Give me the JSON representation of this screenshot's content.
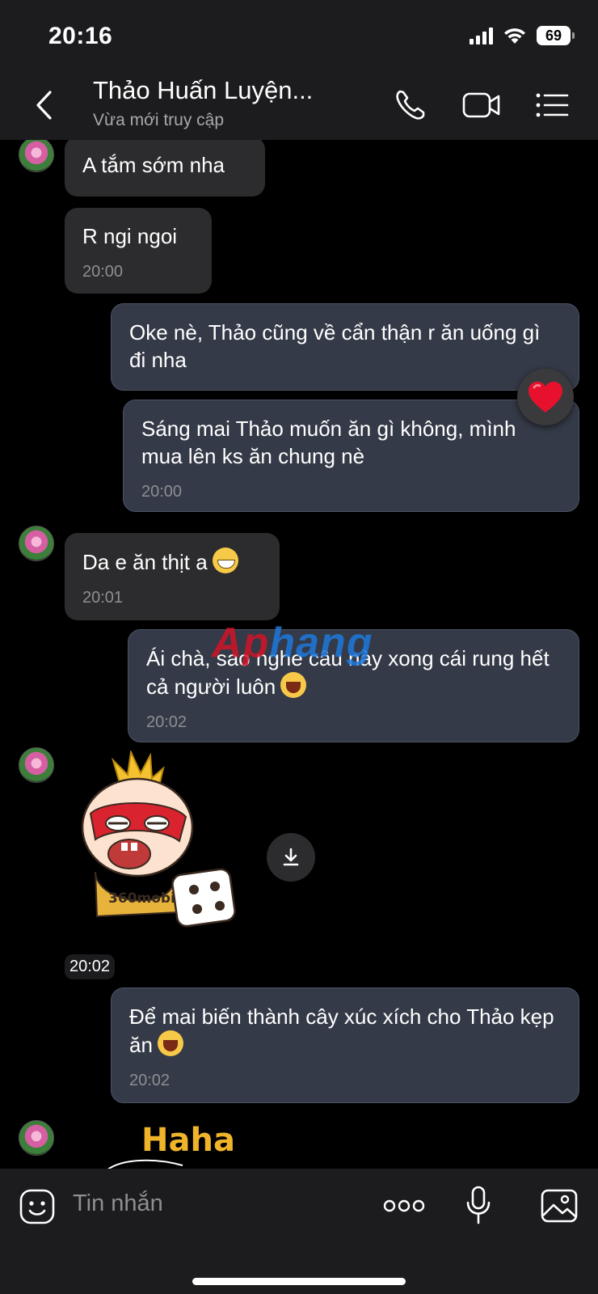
{
  "status_bar": {
    "time": "20:16",
    "battery": "69"
  },
  "header": {
    "back_icon": "chevron-left-icon",
    "contact_name": "Thảo Huấn Luyện...",
    "contact_status": "Vừa mới truy cập",
    "icons": [
      "phone-icon",
      "video-call-icon",
      "menu-list-icon"
    ]
  },
  "messages": [
    {
      "side": "in",
      "text": "A tắm sớm nha",
      "time": ""
    },
    {
      "side": "in",
      "text": "R ngi ngoi",
      "time": "20:00"
    },
    {
      "side": "out",
      "text": "Oke nè, Thảo cũng về cẩn thận r ăn uống gì đi nha",
      "time": ""
    },
    {
      "side": "out",
      "text": "Sáng mai Thảo muốn ăn gì không, mình mua lên ks ăn chung nè",
      "time": "20:00",
      "reaction": "heart-icon"
    },
    {
      "side": "in",
      "text": "Da e ăn thịt a",
      "emoji": "grin-emoji",
      "time": "20:01"
    },
    {
      "side": "out",
      "text": "Ái chà, sao nghe câu này xong cái rung hết cả người luôn",
      "emoji": "laugh-emoji",
      "time": "20:02"
    },
    {
      "side": "in",
      "type": "sticker",
      "sticker_text": "360mobi",
      "time": "20:02"
    },
    {
      "side": "out",
      "text": "Để mai biến thành cây xúc xích cho Thảo kẹp ăn",
      "emoji": "laugh-emoji",
      "time": "20:02"
    },
    {
      "side": "in",
      "type": "sticker",
      "sticker_text": "Haha"
    }
  ],
  "watermark": {
    "part1": "Ap",
    "part2": "hang"
  },
  "input_bar": {
    "placeholder": "Tin nhắn",
    "icons": [
      "sticker-icon",
      "more-icon",
      "microphone-icon",
      "image-icon"
    ]
  },
  "colors": {
    "background": "#000000",
    "bar": "#1c1c1e",
    "incoming": "#2c2c2e",
    "outgoing": "#343a47",
    "heart": "#e8112d"
  }
}
